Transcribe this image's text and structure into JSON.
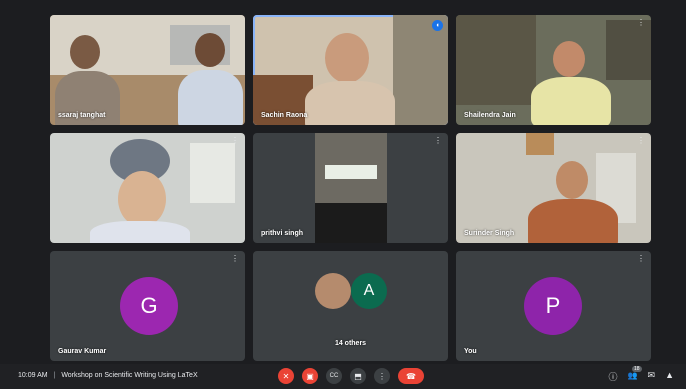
{
  "meeting": {
    "time": "10:09 AM",
    "separator": "|",
    "title": "Workshop on Scientific Writing Using LaTeX"
  },
  "tiles": [
    {
      "name": "ssaraj tanghat"
    },
    {
      "name": "Sachin Raona"
    },
    {
      "name": "Shailendra Jain"
    },
    {
      "name": ""
    },
    {
      "name": "prithvi singh"
    },
    {
      "name": "Surinder Singh"
    },
    {
      "name": "Gaurav Kumar",
      "avatar_letter": "G",
      "avatar_color": "#9c27b0"
    },
    {
      "name": "14 others",
      "avatar_letter": "A",
      "avatar_color": "#0b6b4f"
    },
    {
      "name": "You",
      "avatar_letter": "P",
      "avatar_color": "#8e24aa"
    }
  ],
  "icons": {
    "more": "⋮",
    "speaking": "◖",
    "mic": "mic-off-icon",
    "camera": "camera-off-icon",
    "captions": "captions-icon",
    "present": "present-icon",
    "more_options": "more-options-icon",
    "hangup": "hangup-icon"
  },
  "controls": {
    "mic": "✕",
    "cam": "▣",
    "cc": "CC",
    "present": "⬒",
    "more": "⋮",
    "hangup": "☎"
  },
  "right": {
    "info": "ⓘ",
    "people": "👥",
    "people_count": "18",
    "chat": "✉",
    "activities": "▲"
  },
  "colors": {
    "accent": "#8ab4f8",
    "danger": "#ea4335",
    "tile_bg": "#3c4043",
    "bar_bg": "#202124"
  }
}
